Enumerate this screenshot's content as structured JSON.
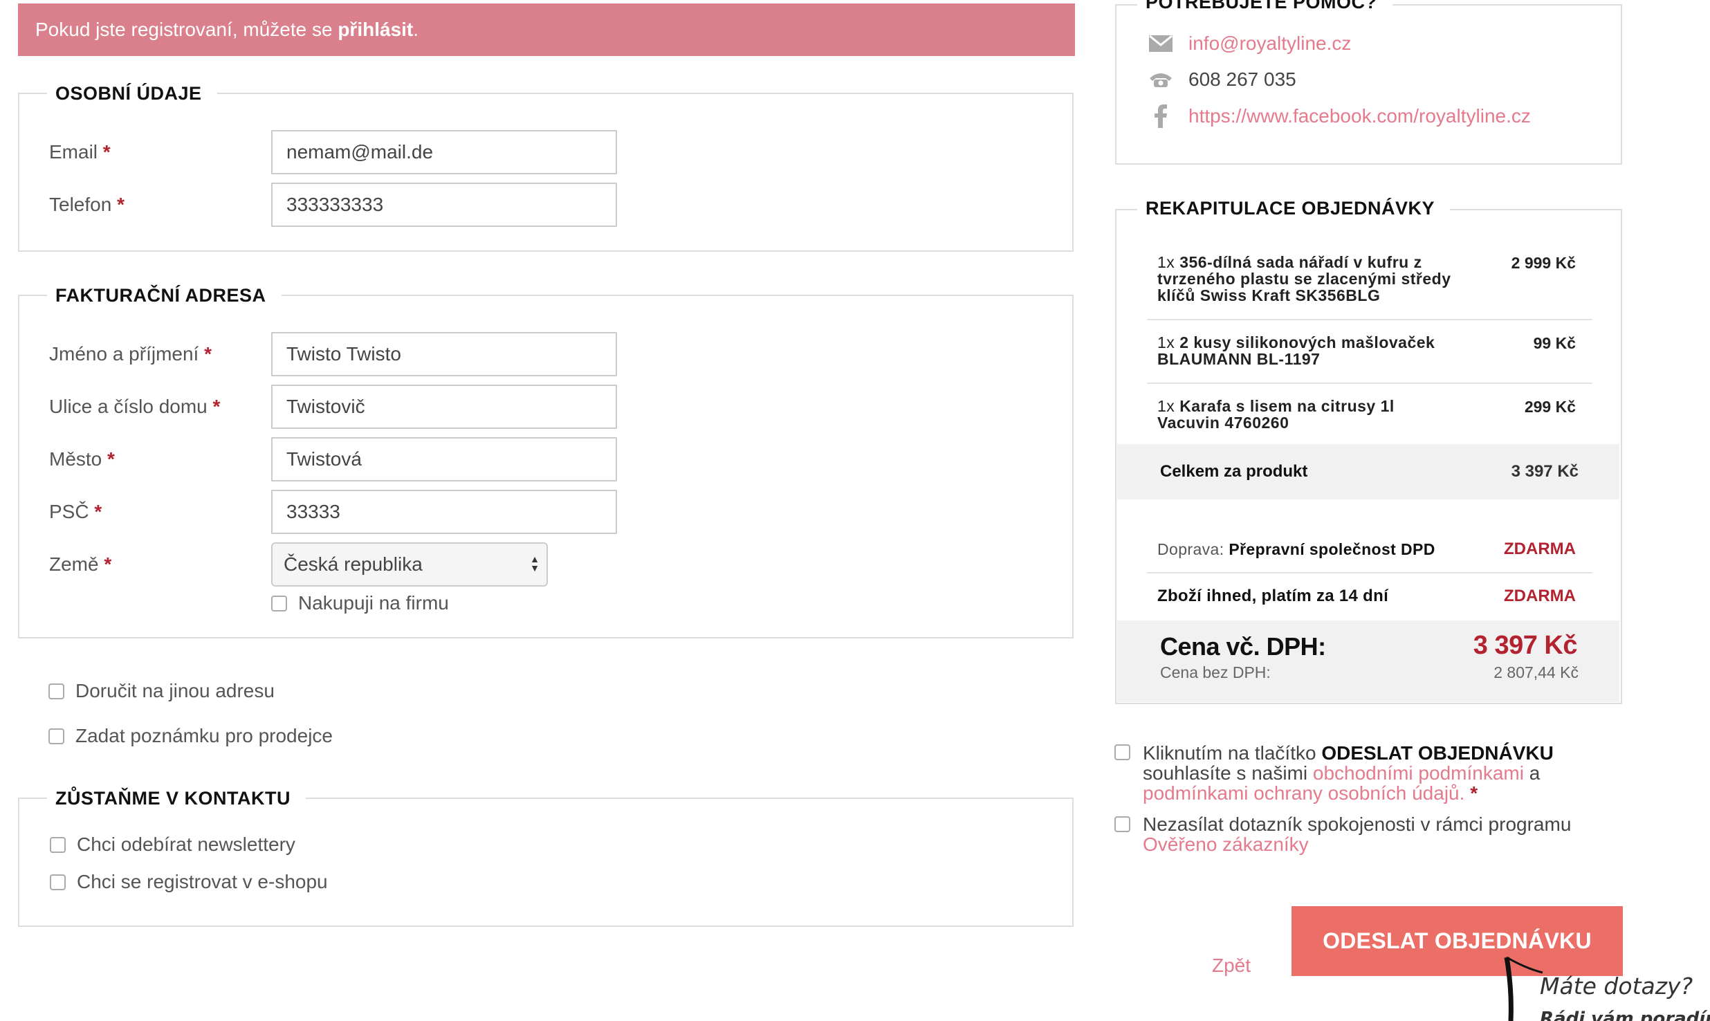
{
  "notice": {
    "text": "Pokud jste registrovaní, můžete se ",
    "link": "přihlásit",
    "end": "."
  },
  "personal": {
    "title": "OSOBNÍ ÚDAJE",
    "email_label": "Email",
    "email_value": "nemam@mail.de",
    "phone_label": "Telefon",
    "phone_value": "333333333"
  },
  "billing": {
    "title": "FAKTURAČNÍ ADRESA",
    "name_label": "Jméno a příjmení",
    "name_value": "Twisto Twisto",
    "street_label": "Ulice a číslo domu",
    "street_value": "Twistovič",
    "city_label": "Město",
    "city_value": "Twistová",
    "zip_label": "PSČ",
    "zip_value": "33333",
    "country_label": "Země",
    "country_value": "Česká republika",
    "company_label": "Nakupuji na firmu"
  },
  "required_mark": "*",
  "options": {
    "other_address": "Doručit na jinou adresu",
    "note": "Zadat poznámku pro prodejce"
  },
  "contact_section": {
    "title": "ZŮSTAŇME V KONTAKTU",
    "newsletter": "Chci odebírat newslettery",
    "register": "Chci se registrovat v e-shopu"
  },
  "help": {
    "title": "POTŘEBUJETE POMOC?",
    "email": "info@royaltyline.cz",
    "phone": "608 267 035",
    "facebook": "https://www.facebook.com/royaltyline.cz"
  },
  "summary": {
    "title": "REKAPITULACE OBJEDNÁVKY",
    "items": [
      {
        "qty": "1x",
        "name": "356-dílná sada nářadí v kufru z tvrzeného plastu se zlacenými středy klíčů Swiss Kraft SK356BLG",
        "price": "2 999 Kč"
      },
      {
        "qty": "1x",
        "name": "2 kusy silikonových mašlovaček BLAUMANN BL-1197",
        "price": "99 Kč"
      },
      {
        "qty": "1x",
        "name": "Karafa s lisem na citrusy 1l Vacuvin 4760260",
        "price": "299 Kč"
      }
    ],
    "product_total_label": "Celkem za produkt",
    "product_total": "3 397 Kč",
    "shipping_prefix": "Doprava: ",
    "shipping_name": "Přepravní společnost DPD",
    "shipping_price": "ZDARMA",
    "payment_name": "Zboží ihned, platím za 14 dní",
    "payment_price": "ZDARMA",
    "total_label": "Cena vč. DPH:",
    "total": "3 397 Kč",
    "net_label": "Cena bez DPH:",
    "net": "2 807,44 Kč"
  },
  "agreement": {
    "pre": "Kliknutím na tlačítko ",
    "strong": "ODESLAT OBJEDNÁVKU",
    "mid": " souhlasíte s našimi ",
    "link1": "obchodními podmínkami",
    "and": " a ",
    "link2": "podmínkami ochrany osobních údajů",
    "dot": ". "
  },
  "survey": {
    "text": "Nezasílat dotazník spokojenosti v rámci programu ",
    "link": "Ověřeno zákazníky"
  },
  "submit_label": "ODESLAT OBJEDNÁVKU",
  "back_label": "Zpět",
  "chat_bubble": "Máte dotazy?",
  "chat_bubble_2": "Rádi vám poradím",
  "colors": {
    "accent": "#ec6f67",
    "notice": "#d9808c",
    "link": "#e47a8c",
    "required": "#b3232f"
  }
}
